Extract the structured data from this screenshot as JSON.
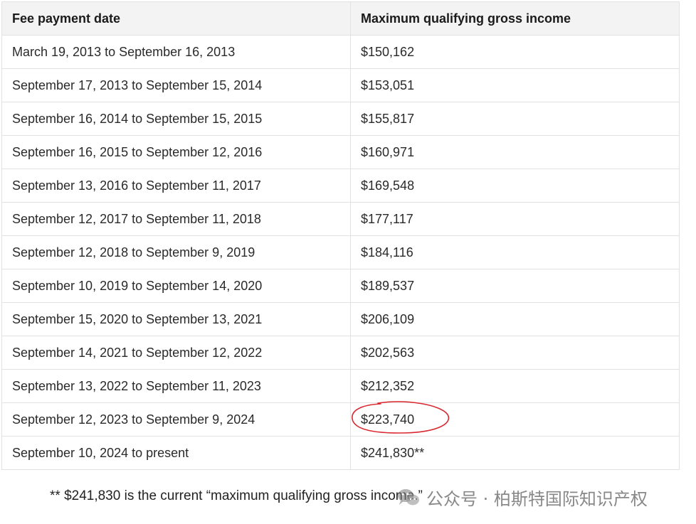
{
  "table": {
    "headers": [
      "Fee payment date",
      "Maximum qualifying gross income"
    ],
    "rows": [
      [
        "March 19, 2013 to September 16, 2013",
        "$150,162"
      ],
      [
        "September 17, 2013 to September 15, 2014",
        "$153,051"
      ],
      [
        "September 16, 2014 to September 15, 2015",
        "$155,817"
      ],
      [
        "September 16, 2015 to September 12, 2016",
        "$160,971"
      ],
      [
        "September 13, 2016 to September 11, 2017",
        "$169,548"
      ],
      [
        "September 12, 2017 to September 11, 2018",
        "$177,117"
      ],
      [
        "September 12, 2018 to September 9, 2019",
        "$184,116"
      ],
      [
        "September 10, 2019 to September 14, 2020",
        "$189,537"
      ],
      [
        "September 15, 2020 to September 13, 2021",
        "$206,109"
      ],
      [
        "September 14, 2021 to September 12, 2022",
        "$202,563"
      ],
      [
        "September 13, 2022 to September 11, 2023",
        "$212,352"
      ],
      [
        "September 12, 2023 to September 9, 2024",
        "$223,740"
      ],
      [
        "September 10, 2024 to present",
        "$241,830**"
      ]
    ],
    "highlighted_row": 11,
    "highlight_color": "#d9282f"
  },
  "footnote": "** $241,830 is the current “maximum qualifying gross income.”",
  "watermark": {
    "icon": "wechat-icon",
    "text": "公众号 · 柏斯特国际知识产权"
  }
}
